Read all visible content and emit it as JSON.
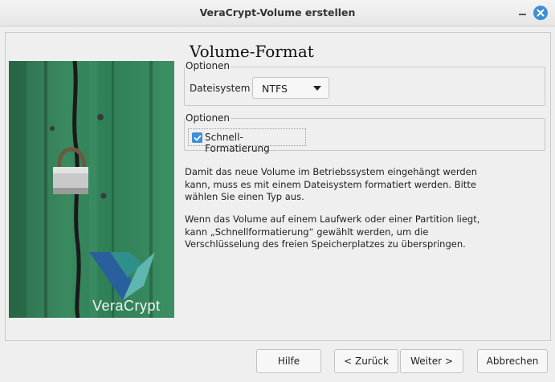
{
  "window": {
    "title": "VeraCrypt-Volume erstellen"
  },
  "page": {
    "heading": "Volume-Format"
  },
  "brand": {
    "name": "VeraCrypt"
  },
  "options_group_1": {
    "label": "Optionen",
    "filesystem_label": "Dateisystem",
    "filesystem_value": "NTFS"
  },
  "options_group_2": {
    "label": "Optionen",
    "quick_format_label": "Schnell-Formatierung",
    "quick_format_checked": true
  },
  "info": {
    "line1": "Damit das neue Volume im Betriebssystem eingehängt werden",
    "line2": "kann, muss es mit einem Dateisystem formatiert werden. Bitte",
    "line3": "wählen Sie einen Typ aus.",
    "line4": "Wenn das Volume auf einem Laufwerk oder einer Partition liegt,",
    "line5": "kann „Schnellformatierung“ gewählt werden, um die",
    "line6": "Verschlüsselung des freien Speicherplatzes zu überspringen."
  },
  "buttons": {
    "help": "Hilfe",
    "back": "< Zurück",
    "next": "Weiter >",
    "cancel": "Abbrechen"
  },
  "icons": {
    "minimize": "minimize-icon",
    "close": "close-icon",
    "checkbox": "checkmark-icon",
    "dropdown": "chevron-down-icon",
    "logo": "veracrypt-logo-icon"
  },
  "colors": {
    "accent": "#3d8fd8",
    "door_green": "#2f7f57"
  }
}
